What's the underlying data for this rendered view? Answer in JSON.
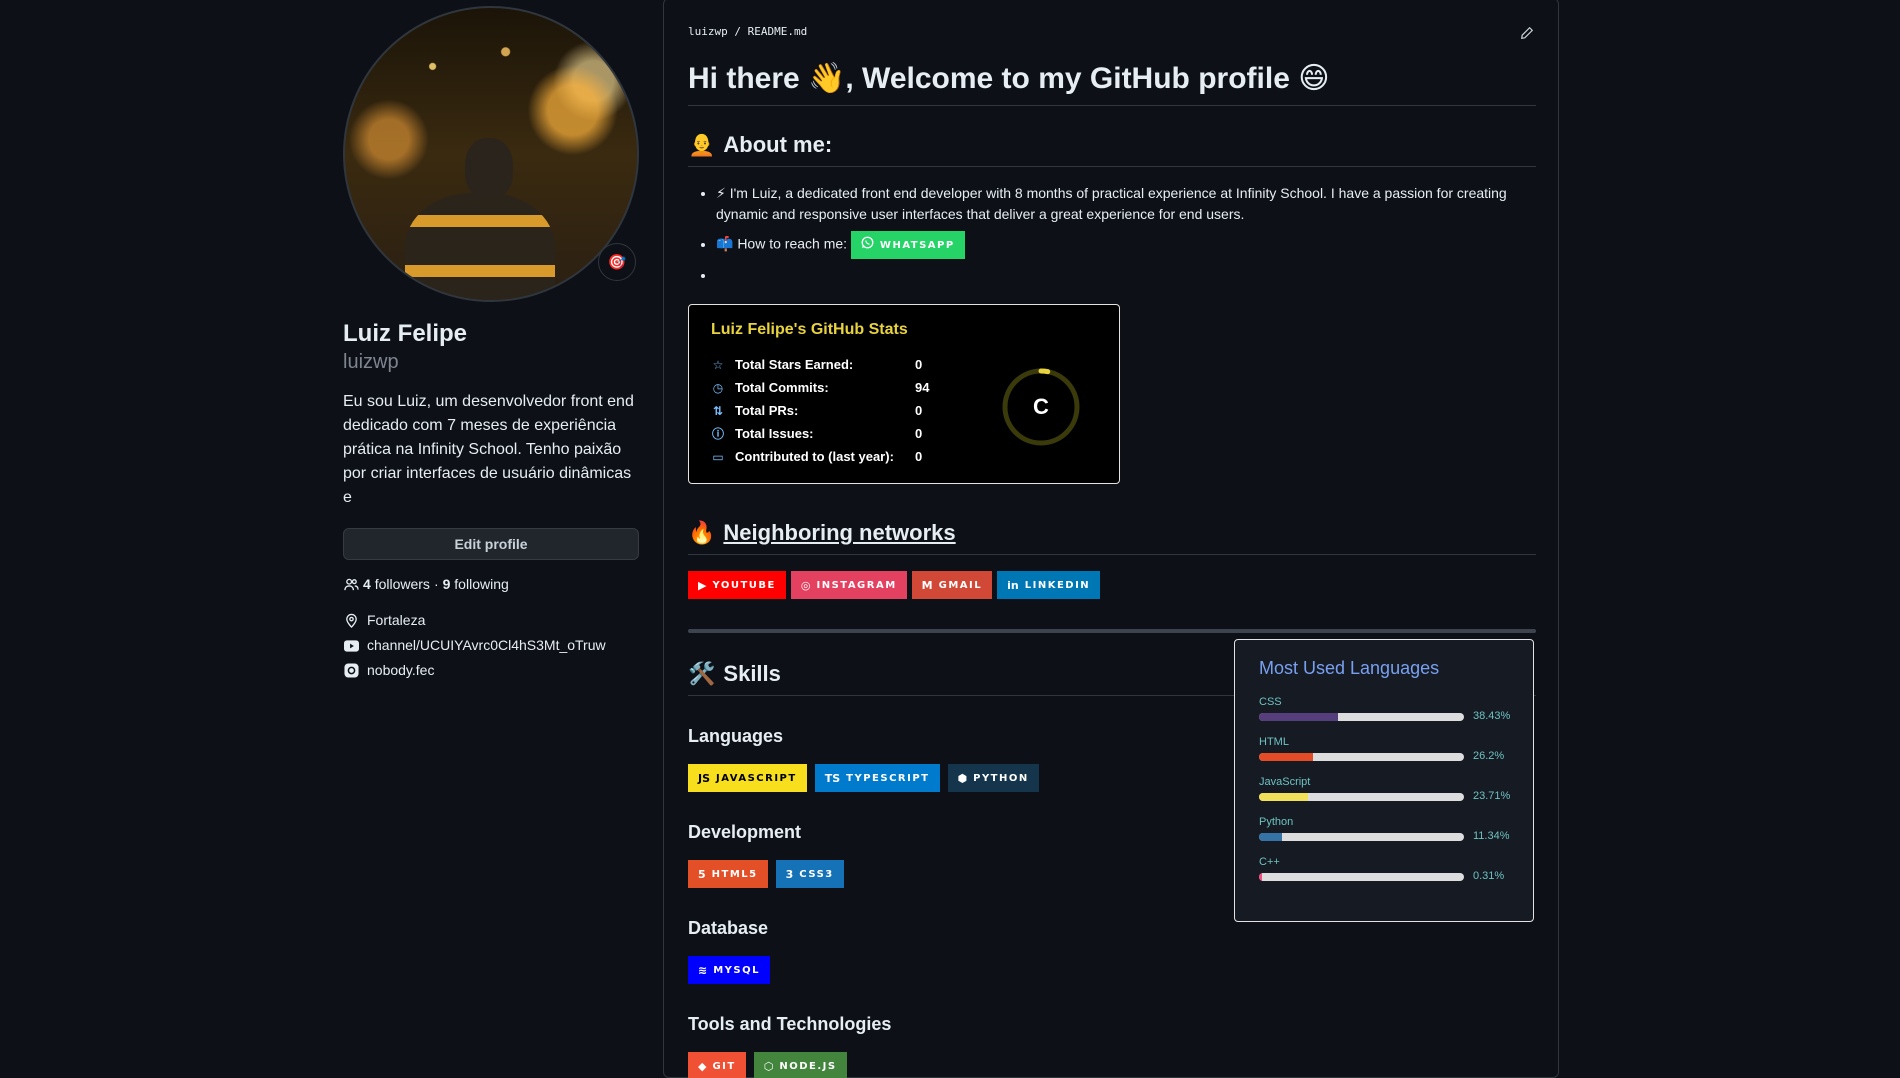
{
  "profile": {
    "fullname": "Luiz Felipe",
    "username": "luizwp",
    "bio": "Eu sou Luiz, um desenvolvedor front end dedicado com 7 meses de experiência prática na Infinity School. Tenho paixão por criar interfaces de usuário dinâmicas e",
    "edit_label": "Edit profile",
    "followers": "4",
    "followers_label": "followers",
    "separator": "·",
    "following": "9",
    "following_label": "following",
    "location": "Fortaleza",
    "youtube": "channel/UCUIYAvrc0Cl4hS3Mt_oTruw",
    "instagram": "nobody.fec",
    "status_emoji": "🎯"
  },
  "readme": {
    "crumb": "luizwp / README.md",
    "title": "Hi there 👋, Welcome to my GitHub profile 😄",
    "about_heading": "About me:",
    "about_emoji": "🧑‍🦲",
    "about_text": "⚡ I'm Luiz, a dedicated front end developer with 8 months of practical experience at Infinity School. I have a passion for creating dynamic and responsive user interfaces that deliver a great experience for end users.",
    "reach_text": "📫 How to reach me:",
    "whatsapp_label": "WHATSAPP",
    "networks_heading": "Neighboring networks",
    "networks_emoji": "🔥",
    "networks": [
      {
        "label": "YOUTUBE",
        "color": "#ff0000",
        "icon": "youtube-icon"
      },
      {
        "label": "INSTAGRAM",
        "color": "#e4405f",
        "icon": "instagram-icon"
      },
      {
        "label": "GMAIL",
        "color": "#d14836",
        "icon": "gmail-icon"
      },
      {
        "label": "LINKEDIN",
        "color": "#0077b5",
        "icon": "linkedin-icon"
      }
    ],
    "skills_heading": "Skills",
    "skills_emoji": "🛠️",
    "languages_heading": "Languages",
    "languages": [
      {
        "label": "JAVASCRIPT",
        "color": "#f7df1e",
        "text": "#000000",
        "icon": "js-icon"
      },
      {
        "label": "TYPESCRIPT",
        "color": "#007acc",
        "text": "#ffffff",
        "icon": "ts-icon"
      },
      {
        "label": "PYTHON",
        "color": "#14354c",
        "text": "#ffffff",
        "icon": "python-icon"
      }
    ],
    "development_heading": "Development",
    "development": [
      {
        "label": "HTML5",
        "color": "#e34f26",
        "icon": "html5-icon"
      },
      {
        "label": "CSS3",
        "color": "#1572b6",
        "icon": "css3-icon"
      }
    ],
    "database_heading": "Database",
    "database": [
      {
        "label": "MYSQL",
        "color": "#0000ff",
        "icon": "mysql-icon"
      }
    ],
    "tools_heading": "Tools and Technologies",
    "tools": [
      {
        "label": "GIT",
        "color": "#f05033",
        "icon": "git-icon"
      },
      {
        "label": "NODE.JS",
        "color": "#43853d",
        "icon": "nodejs-icon"
      }
    ]
  },
  "stats": {
    "title": "Luiz Felipe's GitHub Stats",
    "rank": "C",
    "rank_progress": 0.03,
    "rows": [
      {
        "label": "Total Stars Earned:",
        "value": "0",
        "icon": "star-icon"
      },
      {
        "label": "Total Commits:",
        "value": "94",
        "icon": "history-icon"
      },
      {
        "label": "Total PRs:",
        "value": "0",
        "icon": "pull-request-icon"
      },
      {
        "label": "Total Issues:",
        "value": "0",
        "icon": "issue-icon"
      },
      {
        "label": "Contributed to (last year):",
        "value": "0",
        "icon": "repo-icon"
      }
    ]
  },
  "top_langs": {
    "title": "Most Used Languages",
    "items": [
      {
        "name": "CSS",
        "pct": "38.43%",
        "value": 38.43,
        "color": "#563d7c"
      },
      {
        "name": "HTML",
        "pct": "26.2%",
        "value": 26.2,
        "color": "#e34c26"
      },
      {
        "name": "JavaScript",
        "pct": "23.71%",
        "value": 23.71,
        "color": "#f1e05a"
      },
      {
        "name": "Python",
        "pct": "11.34%",
        "value": 11.34,
        "color": "#3572a5"
      },
      {
        "name": "C++",
        "pct": "0.31%",
        "value": 0.31,
        "color": "#f34b7d"
      }
    ]
  }
}
